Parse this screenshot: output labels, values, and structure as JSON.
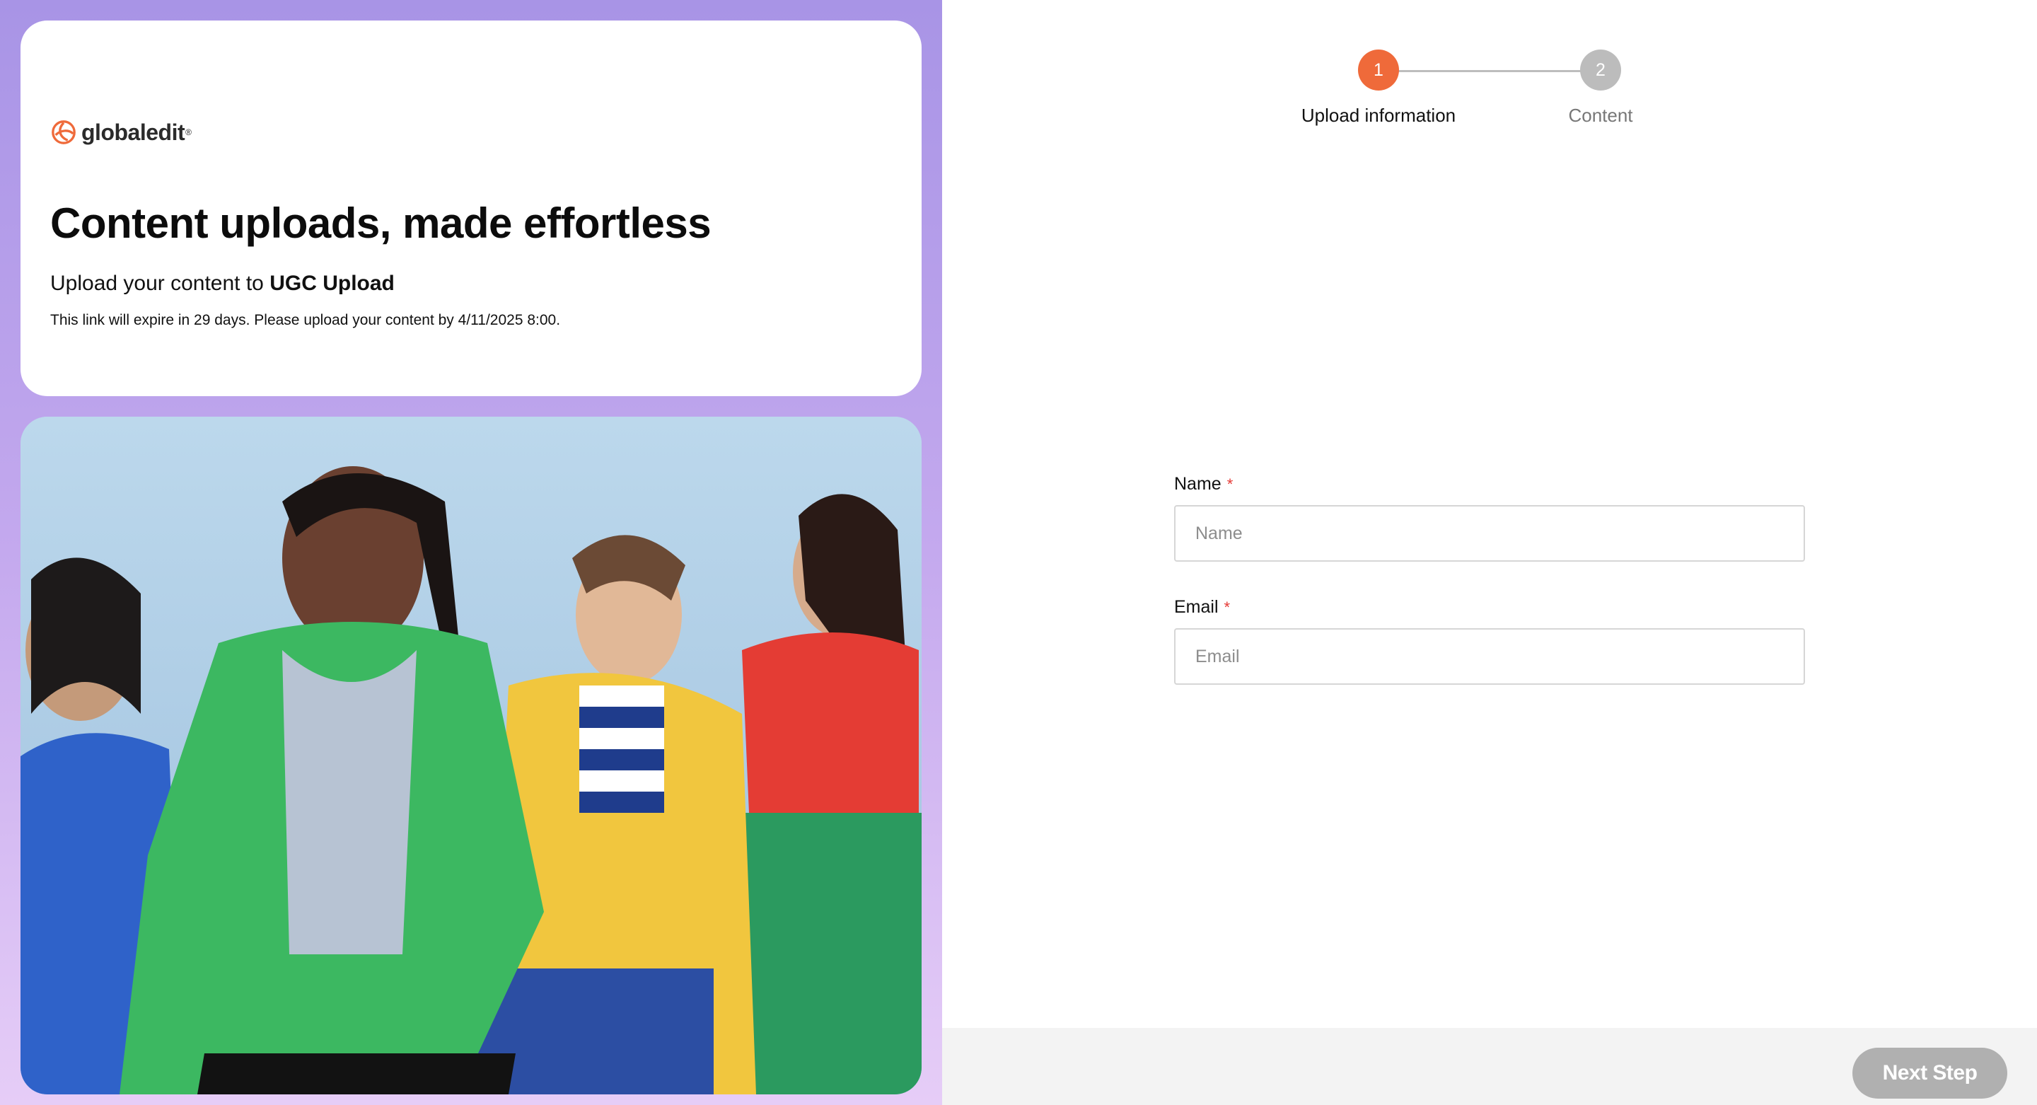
{
  "brand": {
    "name": "globaledit",
    "registered_mark": "®",
    "accent_color": "#ef6a3a"
  },
  "hero": {
    "headline": "Content uploads, made effortless",
    "subline_prefix": "Upload your content to ",
    "subline_target": "UGC Upload",
    "expiry_text": "This link will expire in 29 days. Please upload your content by 4/11/2025 8:00."
  },
  "stepper": {
    "steps": [
      {
        "number": "1",
        "label": "Upload information",
        "state": "active"
      },
      {
        "number": "2",
        "label": "Content",
        "state": "inactive"
      }
    ]
  },
  "form": {
    "name": {
      "label": "Name",
      "required_mark": "*",
      "placeholder": "Name",
      "value": ""
    },
    "email": {
      "label": "Email",
      "required_mark": "*",
      "placeholder": "Email",
      "value": ""
    }
  },
  "footer": {
    "next_label": "Next Step"
  }
}
